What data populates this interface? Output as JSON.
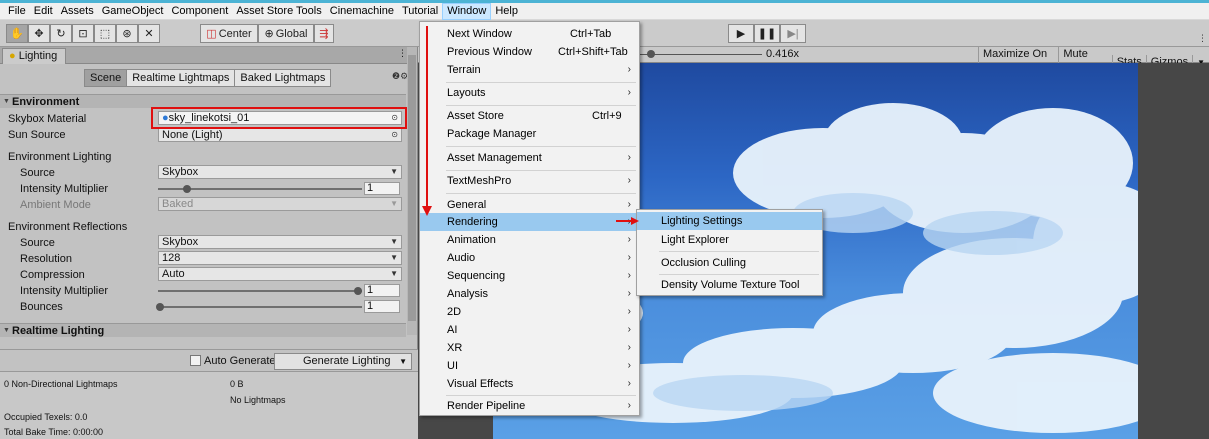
{
  "menubar": {
    "items": [
      "File",
      "Edit",
      "Assets",
      "GameObject",
      "Component",
      "Asset Store Tools",
      "Cinemachine",
      "Tutorial",
      "Window",
      "Help"
    ],
    "active": "Window"
  },
  "toolbar": {
    "center_label": "Center",
    "global_label": "Global"
  },
  "lighting_panel": {
    "tab_title": "Lighting",
    "segments": [
      "Scene",
      "Realtime Lightmaps",
      "Baked Lightmaps"
    ],
    "environment": {
      "header": "Environment",
      "skybox_material_label": "Skybox Material",
      "skybox_material_value": "sky_linekotsi_01",
      "sun_source_label": "Sun Source",
      "sun_source_value": "None (Light)",
      "env_lighting_label": "Environment Lighting",
      "source_label": "Source",
      "source_value": "Skybox",
      "intensity_label": "Intensity Multiplier",
      "intensity_value": "1",
      "ambient_mode_label": "Ambient Mode",
      "ambient_mode_value": "Baked",
      "env_reflections_label": "Environment Reflections",
      "refl_source_label": "Source",
      "refl_source_value": "Skybox",
      "resolution_label": "Resolution",
      "resolution_value": "128",
      "compression_label": "Compression",
      "compression_value": "Auto",
      "refl_intensity_label": "Intensity Multiplier",
      "refl_intensity_value": "1",
      "bounces_label": "Bounces",
      "bounces_value": "1"
    },
    "realtime_header": "Realtime Lighting",
    "auto_generate_label": "Auto Generate",
    "generate_button": "Generate Lighting",
    "stats": {
      "lightmaps_label": "0 Non-Directional Lightmaps",
      "size_value": "0 B",
      "no_lightmaps": "No Lightmaps",
      "occupied": "Occupied Texels: 0.0",
      "bake_time": "Total Bake Time: 0:00:00"
    }
  },
  "game_view": {
    "scale_fragment": "e",
    "scale_value": "0.416x",
    "buttons": [
      "Maximize On Play",
      "Mute Audio",
      "Stats",
      "Gizmos"
    ]
  },
  "window_menu": {
    "items": [
      {
        "label": "Next Window",
        "shortcut": "Ctrl+Tab",
        "submenu": false
      },
      {
        "label": "Previous Window",
        "shortcut": "Ctrl+Shift+Tab",
        "submenu": false
      },
      {
        "label": "Terrain",
        "shortcut": "",
        "submenu": true
      },
      {
        "label": "Layouts",
        "shortcut": "",
        "submenu": true
      },
      {
        "label": "Asset Store",
        "shortcut": "Ctrl+9",
        "submenu": false
      },
      {
        "label": "Package Manager",
        "shortcut": "",
        "submenu": false
      },
      {
        "label": "Asset Management",
        "shortcut": "",
        "submenu": true
      },
      {
        "label": "TextMeshPro",
        "shortcut": "",
        "submenu": true
      },
      {
        "label": "General",
        "shortcut": "",
        "submenu": true
      },
      {
        "label": "Rendering",
        "shortcut": "",
        "submenu": true
      },
      {
        "label": "Animation",
        "shortcut": "",
        "submenu": true
      },
      {
        "label": "Audio",
        "shortcut": "",
        "submenu": true
      },
      {
        "label": "Sequencing",
        "shortcut": "",
        "submenu": true
      },
      {
        "label": "Analysis",
        "shortcut": "",
        "submenu": true
      },
      {
        "label": "2D",
        "shortcut": "",
        "submenu": true
      },
      {
        "label": "AI",
        "shortcut": "",
        "submenu": true
      },
      {
        "label": "XR",
        "shortcut": "",
        "submenu": true
      },
      {
        "label": "UI",
        "shortcut": "",
        "submenu": true
      },
      {
        "label": "Visual Effects",
        "shortcut": "",
        "submenu": true
      },
      {
        "label": "Render Pipeline",
        "shortcut": "",
        "submenu": true
      }
    ],
    "highlighted": "Rendering"
  },
  "rendering_submenu": {
    "items": [
      "Lighting Settings",
      "Light Explorer",
      "Occlusion Culling",
      "Density Volume Texture Tool"
    ],
    "highlighted": "Lighting Settings"
  },
  "colors": {
    "accent_red": "#e01010",
    "menu_highlight": "#99c9ef",
    "menubar_active": "#cce8ff"
  }
}
